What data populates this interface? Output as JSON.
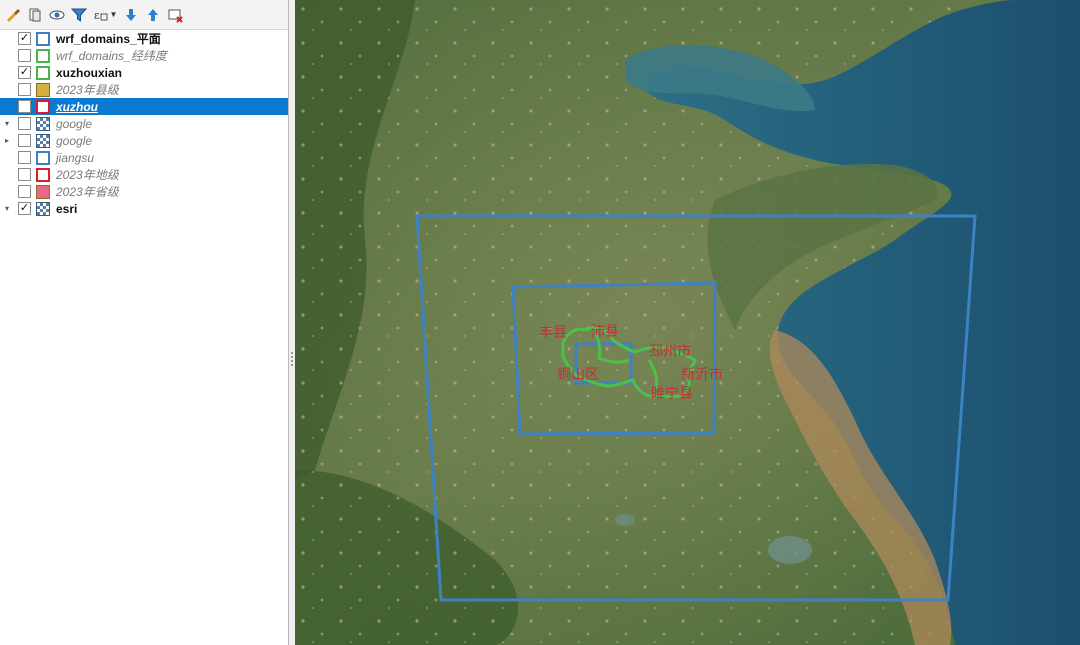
{
  "toolbar": {
    "tools": [
      {
        "name": "style-manager-icon"
      },
      {
        "name": "add-group-icon"
      },
      {
        "name": "manage-visibility-icon"
      },
      {
        "name": "filter-legend-icon"
      },
      {
        "name": "filter-expression-icon"
      },
      {
        "name": "expand-all-icon"
      },
      {
        "name": "collapse-all-icon"
      },
      {
        "name": "remove-layer-icon"
      }
    ]
  },
  "layers": [
    {
      "label": "wrf_domains_平面",
      "checked": "✓",
      "symbol": "outline",
      "color": "#3c7fc1",
      "state": "on"
    },
    {
      "label": "wrf_domains_经纬度",
      "checked": "",
      "symbol": "outline",
      "color": "#4cb34c",
      "state": "off"
    },
    {
      "label": "xuzhouxian",
      "checked": "✓",
      "symbol": "outline",
      "color": "#4cb34c",
      "state": "on"
    },
    {
      "label": "2023年县级",
      "checked": "",
      "symbol": "fill",
      "color": "#d4b040",
      "state": "off"
    },
    {
      "label": "xuzhou",
      "checked": "",
      "symbol": "outline",
      "color": "#d81e2c",
      "state": "selected"
    },
    {
      "label": "google",
      "checked": "",
      "symbol": "raster",
      "color": "#5a7ea8",
      "state": "off",
      "expander": "▾"
    },
    {
      "label": "google",
      "checked": "",
      "symbol": "raster",
      "color": "#5a7ea8",
      "state": "off",
      "expander": "▸"
    },
    {
      "label": "jiangsu",
      "checked": "",
      "symbol": "outline",
      "color": "#3c7fc1",
      "state": "off"
    },
    {
      "label": "2023年地级",
      "checked": "",
      "symbol": "outline",
      "color": "#d81e2c",
      "state": "off"
    },
    {
      "label": "2023年省级",
      "checked": "",
      "symbol": "fill",
      "color": "#e8688a",
      "state": "off"
    },
    {
      "label": "esri",
      "checked": "✓",
      "symbol": "raster",
      "color": "#5a7ea8",
      "state": "on",
      "expander": "▾"
    }
  ],
  "map": {
    "county_labels": [
      "丰县",
      "沛县",
      "邳州市",
      "铜山区",
      "新沂市",
      "睢宁县"
    ],
    "colors": {
      "domain_outline": "#3d82c4",
      "county_outline": "#4cc04c",
      "county_label": "#c0303a",
      "sea": "#1f5a78",
      "land": "#4d6a3a"
    }
  }
}
